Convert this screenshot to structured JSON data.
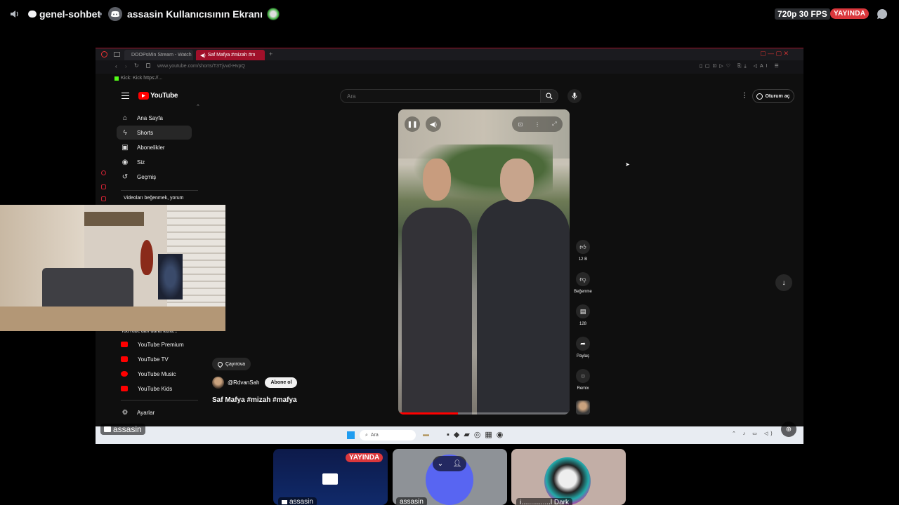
{
  "discord": {
    "channel_name": "genel-sohbet",
    "screen_title": "assasin Kullanıcısının Ekranı",
    "resolution_badge": "720p 30 FPS",
    "live_badge": "YAYINDA",
    "streamer_tag": "assasin"
  },
  "browser": {
    "tabs": [
      {
        "label": "DOOPsMin Stream - Watch"
      },
      {
        "label": "Saf Mafya #mizah #m"
      }
    ],
    "url": "www.youtube.com/shorts/T3Tjvvd-HvpQ",
    "bookmark": "Kick: Kick https://..."
  },
  "youtube": {
    "logo_text": "YouTube",
    "search_placeholder": "Ara",
    "signin_label": "Oturum aç",
    "sidebar": {
      "items": [
        {
          "label": "Ana Sayfa",
          "icon": "home-icon"
        },
        {
          "label": "Shorts",
          "icon": "shorts-icon"
        },
        {
          "label": "Abonelikler",
          "icon": "subscriptions-icon"
        },
        {
          "label": "Siz",
          "icon": "you-icon"
        },
        {
          "label": "Geçmiş",
          "icon": "history-icon"
        }
      ],
      "promo_text": "Videoları beğenmek, yorum",
      "more_heading": "YouTube'dan daha fazla...",
      "more_items": [
        {
          "label": "YouTube Premium"
        },
        {
          "label": "YouTube TV"
        },
        {
          "label": "YouTube Music"
        },
        {
          "label": "YouTube Kids"
        }
      ],
      "settings_label": "Ayarlar"
    },
    "short": {
      "location": "Çayırova",
      "channel": "@RdvanSah",
      "subscribe_label": "Abone ol",
      "title": "Saf Mafya #mizah #mafya",
      "actions": {
        "like_count": "12 B",
        "dislike_label": "Beğenme",
        "comment_count": "128",
        "share_label": "Paylaş",
        "remix_label": "Remix"
      }
    }
  },
  "taskbar": {
    "search_placeholder": "Ara"
  },
  "tiles": [
    {
      "name": "assasin",
      "badge": "YAYINDA"
    },
    {
      "name": "assasin"
    },
    {
      "name": "i...............l Dark"
    }
  ]
}
